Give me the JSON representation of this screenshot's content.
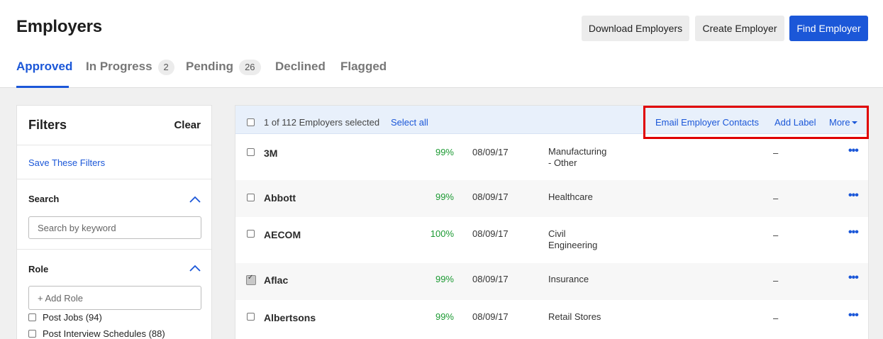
{
  "header": {
    "title": "Employers",
    "download_label": "Download Employers",
    "create_label": "Create Employer",
    "find_label": "Find Employer"
  },
  "tabs": [
    {
      "label": "Approved",
      "count": null,
      "active": true
    },
    {
      "label": "In Progress",
      "count": "2"
    },
    {
      "label": "Pending",
      "count": "26"
    },
    {
      "label": "Declined",
      "count": null
    },
    {
      "label": "Flagged",
      "count": null
    }
  ],
  "filters": {
    "title": "Filters",
    "clear_label": "Clear",
    "save_label": "Save These Filters",
    "search": {
      "title": "Search",
      "placeholder": "Search by keyword"
    },
    "role": {
      "title": "Role",
      "placeholder": "+ Add Role",
      "options": [
        {
          "label": "Post Jobs (94)"
        },
        {
          "label": "Post Interview Schedules (88)"
        }
      ]
    }
  },
  "bulk": {
    "selected_text": "1 of 112 Employers selected",
    "select_all": "Select all",
    "email_contacts": "Email Employer Contacts",
    "add_label": "Add Label",
    "more": "More"
  },
  "employers": [
    {
      "name": "3M",
      "score": "99%",
      "date": "08/09/17",
      "industry_line1": "Manufacturing",
      "industry_line2": "- Other",
      "label": "–",
      "checked": false
    },
    {
      "name": "Abbott",
      "score": "99%",
      "date": "08/09/17",
      "industry_line1": "Healthcare",
      "industry_line2": "",
      "label": "–",
      "checked": false
    },
    {
      "name": "AECOM",
      "score": "100%",
      "date": "08/09/17",
      "industry_line1": "Civil",
      "industry_line2": "Engineering",
      "label": "–",
      "checked": false
    },
    {
      "name": "Aflac",
      "score": "99%",
      "date": "08/09/17",
      "industry_line1": "Insurance",
      "industry_line2": "",
      "label": "–",
      "checked": true
    },
    {
      "name": "Albertsons",
      "score": "99%",
      "date": "08/09/17",
      "industry_line1": "Retail Stores",
      "industry_line2": "",
      "label": "–",
      "checked": false
    }
  ],
  "colors": {
    "accent": "#1b57d8",
    "score_green": "#1c9a33",
    "highlight_red": "#e00000"
  }
}
